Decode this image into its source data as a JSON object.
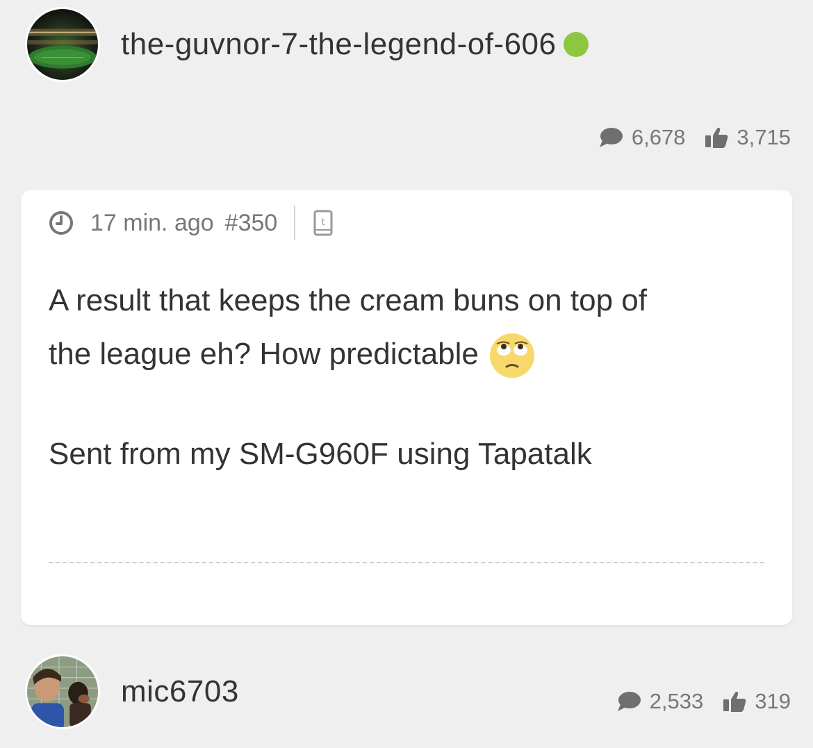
{
  "post": {
    "username": "the-guvnor-7-the-legend-of-606",
    "user_stats": {
      "posts": "6,678",
      "likes": "3,715"
    },
    "time": "17 min. ago",
    "post_number": "#350",
    "body_line1": "A result that keeps the cream buns on top of",
    "body_line2": "the league eh? How predictable",
    "signature": "Sent from my SM-G960F using Tapatalk",
    "icons": [
      "comment-icon",
      "thumbs-up-icon",
      "clock-icon",
      "tapatalk-device-icon",
      "eye-roll-emoji"
    ],
    "online_color": "#8dc63f"
  },
  "next_post": {
    "username": "mic6703",
    "user_stats": {
      "posts": "2,533",
      "likes": "319"
    }
  }
}
